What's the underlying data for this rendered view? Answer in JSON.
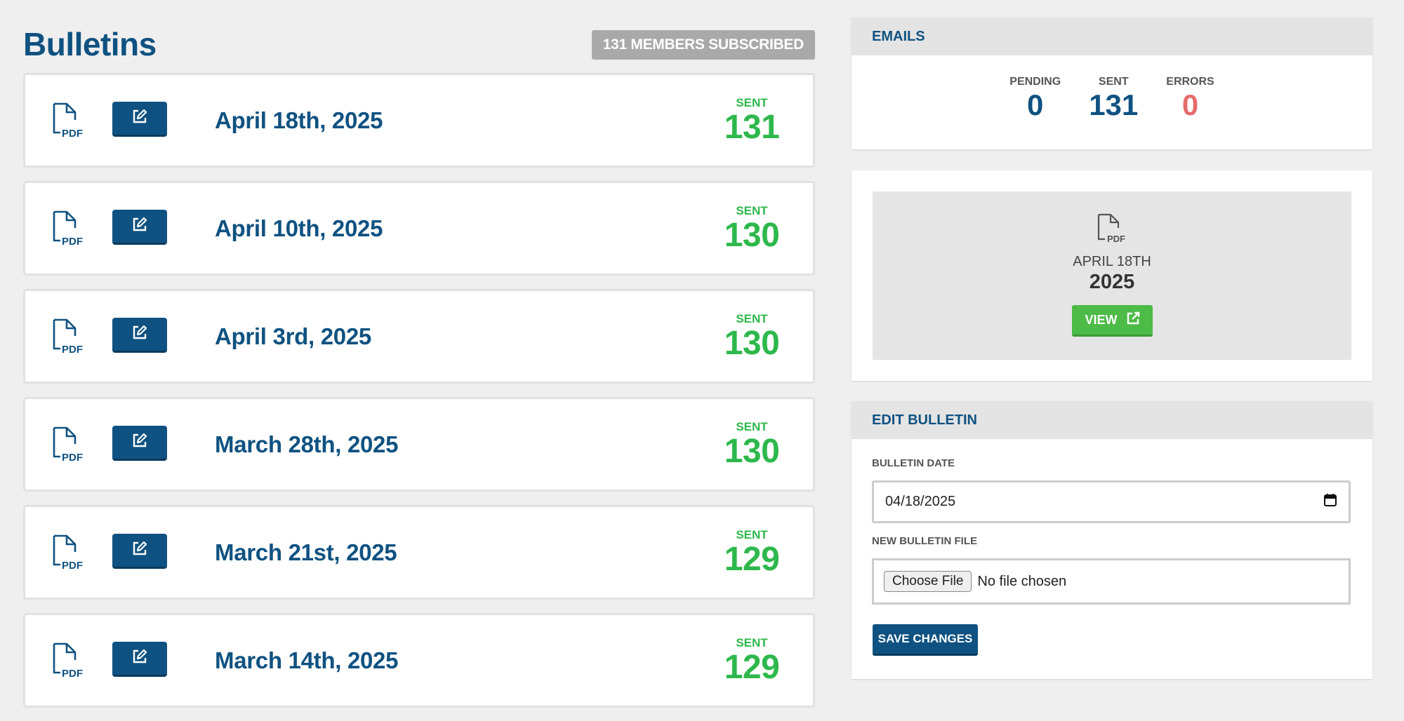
{
  "page": {
    "title": "Bulletins",
    "subscribed_badge": "131 MEMBERS SUBSCRIBED"
  },
  "bulletins": [
    {
      "date": "April 18th, 2025",
      "sent_label": "SENT",
      "sent_count": "131",
      "icon": "pdf-icon",
      "edit_icon": "edit-icon"
    },
    {
      "date": "April 10th, 2025",
      "sent_label": "SENT",
      "sent_count": "130",
      "icon": "pdf-icon",
      "edit_icon": "edit-icon"
    },
    {
      "date": "April 3rd, 2025",
      "sent_label": "SENT",
      "sent_count": "130",
      "icon": "pdf-icon",
      "edit_icon": "edit-icon"
    },
    {
      "date": "March 28th, 2025",
      "sent_label": "SENT",
      "sent_count": "130",
      "icon": "pdf-icon",
      "edit_icon": "edit-icon"
    },
    {
      "date": "March 21st, 2025",
      "sent_label": "SENT",
      "sent_count": "129",
      "icon": "pdf-icon",
      "edit_icon": "edit-icon"
    },
    {
      "date": "March 14th, 2025",
      "sent_label": "SENT",
      "sent_count": "129",
      "icon": "pdf-icon",
      "edit_icon": "edit-icon"
    }
  ],
  "emails": {
    "header": "EMAILS",
    "stats": [
      {
        "label": "PENDING",
        "value": "0"
      },
      {
        "label": "SENT",
        "value": "131"
      },
      {
        "label": "ERRORS",
        "value": "0"
      }
    ]
  },
  "preview": {
    "month": "APRIL 18TH",
    "year": "2025",
    "view_label": "VIEW",
    "view_icon": "external-link-icon"
  },
  "edit": {
    "header": "EDIT BULLETIN",
    "date_label": "BULLETIN DATE",
    "date_value": "04/18/2025",
    "file_label": "NEW BULLETIN FILE",
    "choose_file": "Choose File",
    "no_file": "No file chosen",
    "save_label": "SAVE CHANGES"
  },
  "colors": {
    "brand": "#0f5281",
    "success": "#2eb84c",
    "error": "#e66b6b",
    "badge": "#a9a9a9"
  }
}
